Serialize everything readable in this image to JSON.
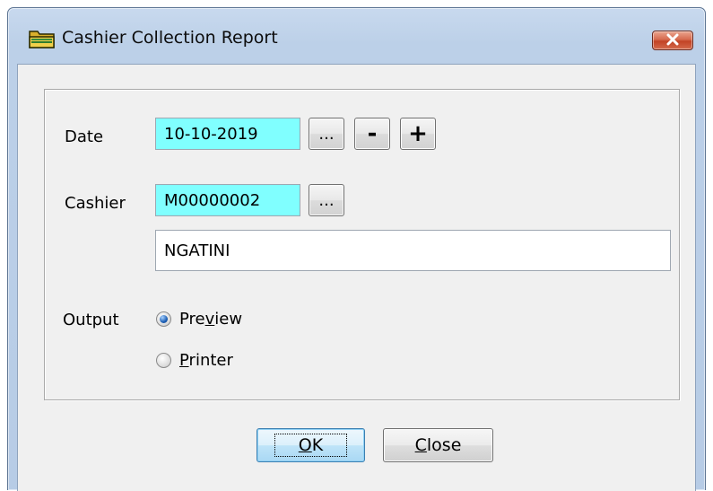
{
  "window": {
    "title": "Cashier Collection Report",
    "title_icon": "folder-icon",
    "close_icon": "close-icon"
  },
  "form": {
    "date": {
      "label": "Date",
      "value": "10-10-2019",
      "browse_label": "...",
      "minus_label": "-",
      "plus_label": "+"
    },
    "cashier": {
      "label": "Cashier",
      "code": "M00000002",
      "browse_label": "...",
      "name": "NGATINI"
    },
    "output": {
      "label": "Output",
      "options": [
        {
          "pre": "Pre",
          "accel": "v",
          "post": "iew",
          "selected": true
        },
        {
          "pre": "",
          "accel": "P",
          "post": "rinter",
          "selected": false
        }
      ]
    }
  },
  "buttons": {
    "ok": {
      "accel": "O",
      "rest": "K"
    },
    "close": {
      "accel": "C",
      "rest": "lose"
    }
  },
  "colors": {
    "input_highlight": "#80ffff",
    "title_bar": "#bcd0e8",
    "close_button": "#c24326",
    "client_bg": "#f0f0f0"
  }
}
